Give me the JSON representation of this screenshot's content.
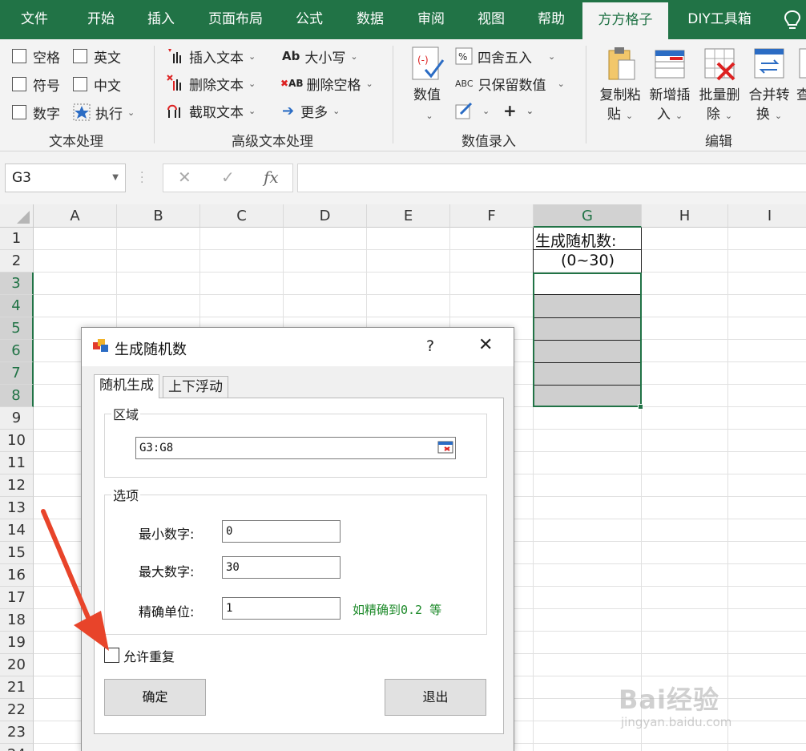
{
  "tabs": [
    "文件",
    "开始",
    "插入",
    "页面布局",
    "公式",
    "数据",
    "审阅",
    "视图",
    "帮助",
    "方方格子",
    "DIY工具箱"
  ],
  "active_tab": "方方格子",
  "ribbon": {
    "text_group": {
      "items": [
        "空格",
        "英文",
        "符号",
        "中文",
        "数字",
        "执行"
      ],
      "label": "文本处理"
    },
    "adv_text_group": {
      "items": [
        "插入文本",
        "删除文本",
        "截取文本",
        "大小写",
        "删除空格",
        "更多"
      ],
      "label": "高级文本处理"
    },
    "number_group": {
      "big_button": "数值",
      "items": [
        "四舍五入",
        "只保留数值"
      ],
      "plus": "+",
      "label": "数值录入"
    },
    "edit_group": {
      "buttons": [
        {
          "line1": "复制粘",
          "line2": "贴"
        },
        {
          "line1": "新增插",
          "line2": "入"
        },
        {
          "line1": "批量删",
          "line2": "除"
        },
        {
          "line1": "合并转",
          "line2": "换"
        },
        {
          "line1": "查",
          "line2": ""
        }
      ],
      "label": "编辑"
    }
  },
  "formula_bar": {
    "name_box": "G3",
    "cancel": "✕",
    "enter": "✓",
    "fx": "fx",
    "value": ""
  },
  "sheet": {
    "columns": [
      "A",
      "B",
      "C",
      "D",
      "E",
      "F",
      "G",
      "H",
      "I"
    ],
    "rows": [
      "1",
      "2",
      "3",
      "4",
      "5",
      "6",
      "7",
      "8",
      "9",
      "10",
      "11",
      "12",
      "13",
      "14",
      "15",
      "16",
      "17",
      "18",
      "19",
      "20",
      "21",
      "22",
      "23",
      "24"
    ],
    "selected_column": "G",
    "selected_rows": [
      "3",
      "4",
      "5",
      "6",
      "7",
      "8"
    ],
    "cells": {
      "G1": "生成随机数:",
      "G2": "(0~30)"
    }
  },
  "dialog": {
    "title": "生成随机数",
    "help": "?",
    "close": "✕",
    "tabs": [
      "随机生成",
      "上下浮动"
    ],
    "active_tab": "随机生成",
    "range_section": {
      "legend": "区域",
      "value": "G3:G8"
    },
    "options_section": {
      "legend": "选项",
      "min_label": "最小数字:",
      "min_value": "0",
      "max_label": "最大数字:",
      "max_value": "30",
      "precision_label": "精确单位:",
      "precision_value": "1",
      "precision_hint": "如精确到0.2 等"
    },
    "allow_repeat_label": "允许重复",
    "allow_repeat_checked": false,
    "ok_button": "确定",
    "exit_button": "退出"
  },
  "colors": {
    "excel_green": "#217346",
    "annotation_arrow": "#e8442a",
    "hint_green": "#1d8a2a"
  },
  "watermark": {
    "brand": "Bai经验",
    "url": "jingyan.baidu.com"
  }
}
